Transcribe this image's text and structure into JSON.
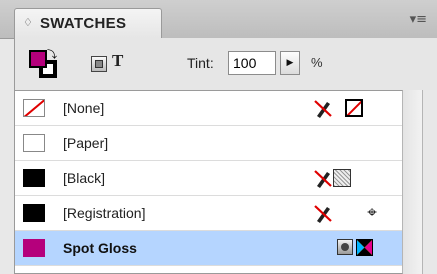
{
  "panel": {
    "tab_arrows": "♢",
    "title": "SWATCHES",
    "menu_icon": "panel-menu-icon",
    "menu_glyph": "▾≡"
  },
  "controls": {
    "fill_color": "#b5007c",
    "text_button_label": "T",
    "tint_label": "Tint:",
    "tint_value": "100",
    "tint_stepper_glyph": "▶",
    "tint_unit": "%"
  },
  "swatches": [
    {
      "label": "[None]",
      "color": "none",
      "edit_locked": true,
      "type_icon": "none-icon"
    },
    {
      "label": "[Paper]",
      "color": "#ffffff",
      "edit_locked": false,
      "type_icon": ""
    },
    {
      "label": "[Black]",
      "color": "#000000",
      "edit_locked": true,
      "type_icon": "process-color-icon"
    },
    {
      "label": "[Registration]",
      "color": "#000000",
      "edit_locked": true,
      "type_icon": "registration-icon"
    },
    {
      "label": "Spot Gloss",
      "color": "#b5007c",
      "edit_locked": false,
      "type_icon": "spot-color-icon",
      "selected": true
    }
  ],
  "registration_glyph": "⌖"
}
